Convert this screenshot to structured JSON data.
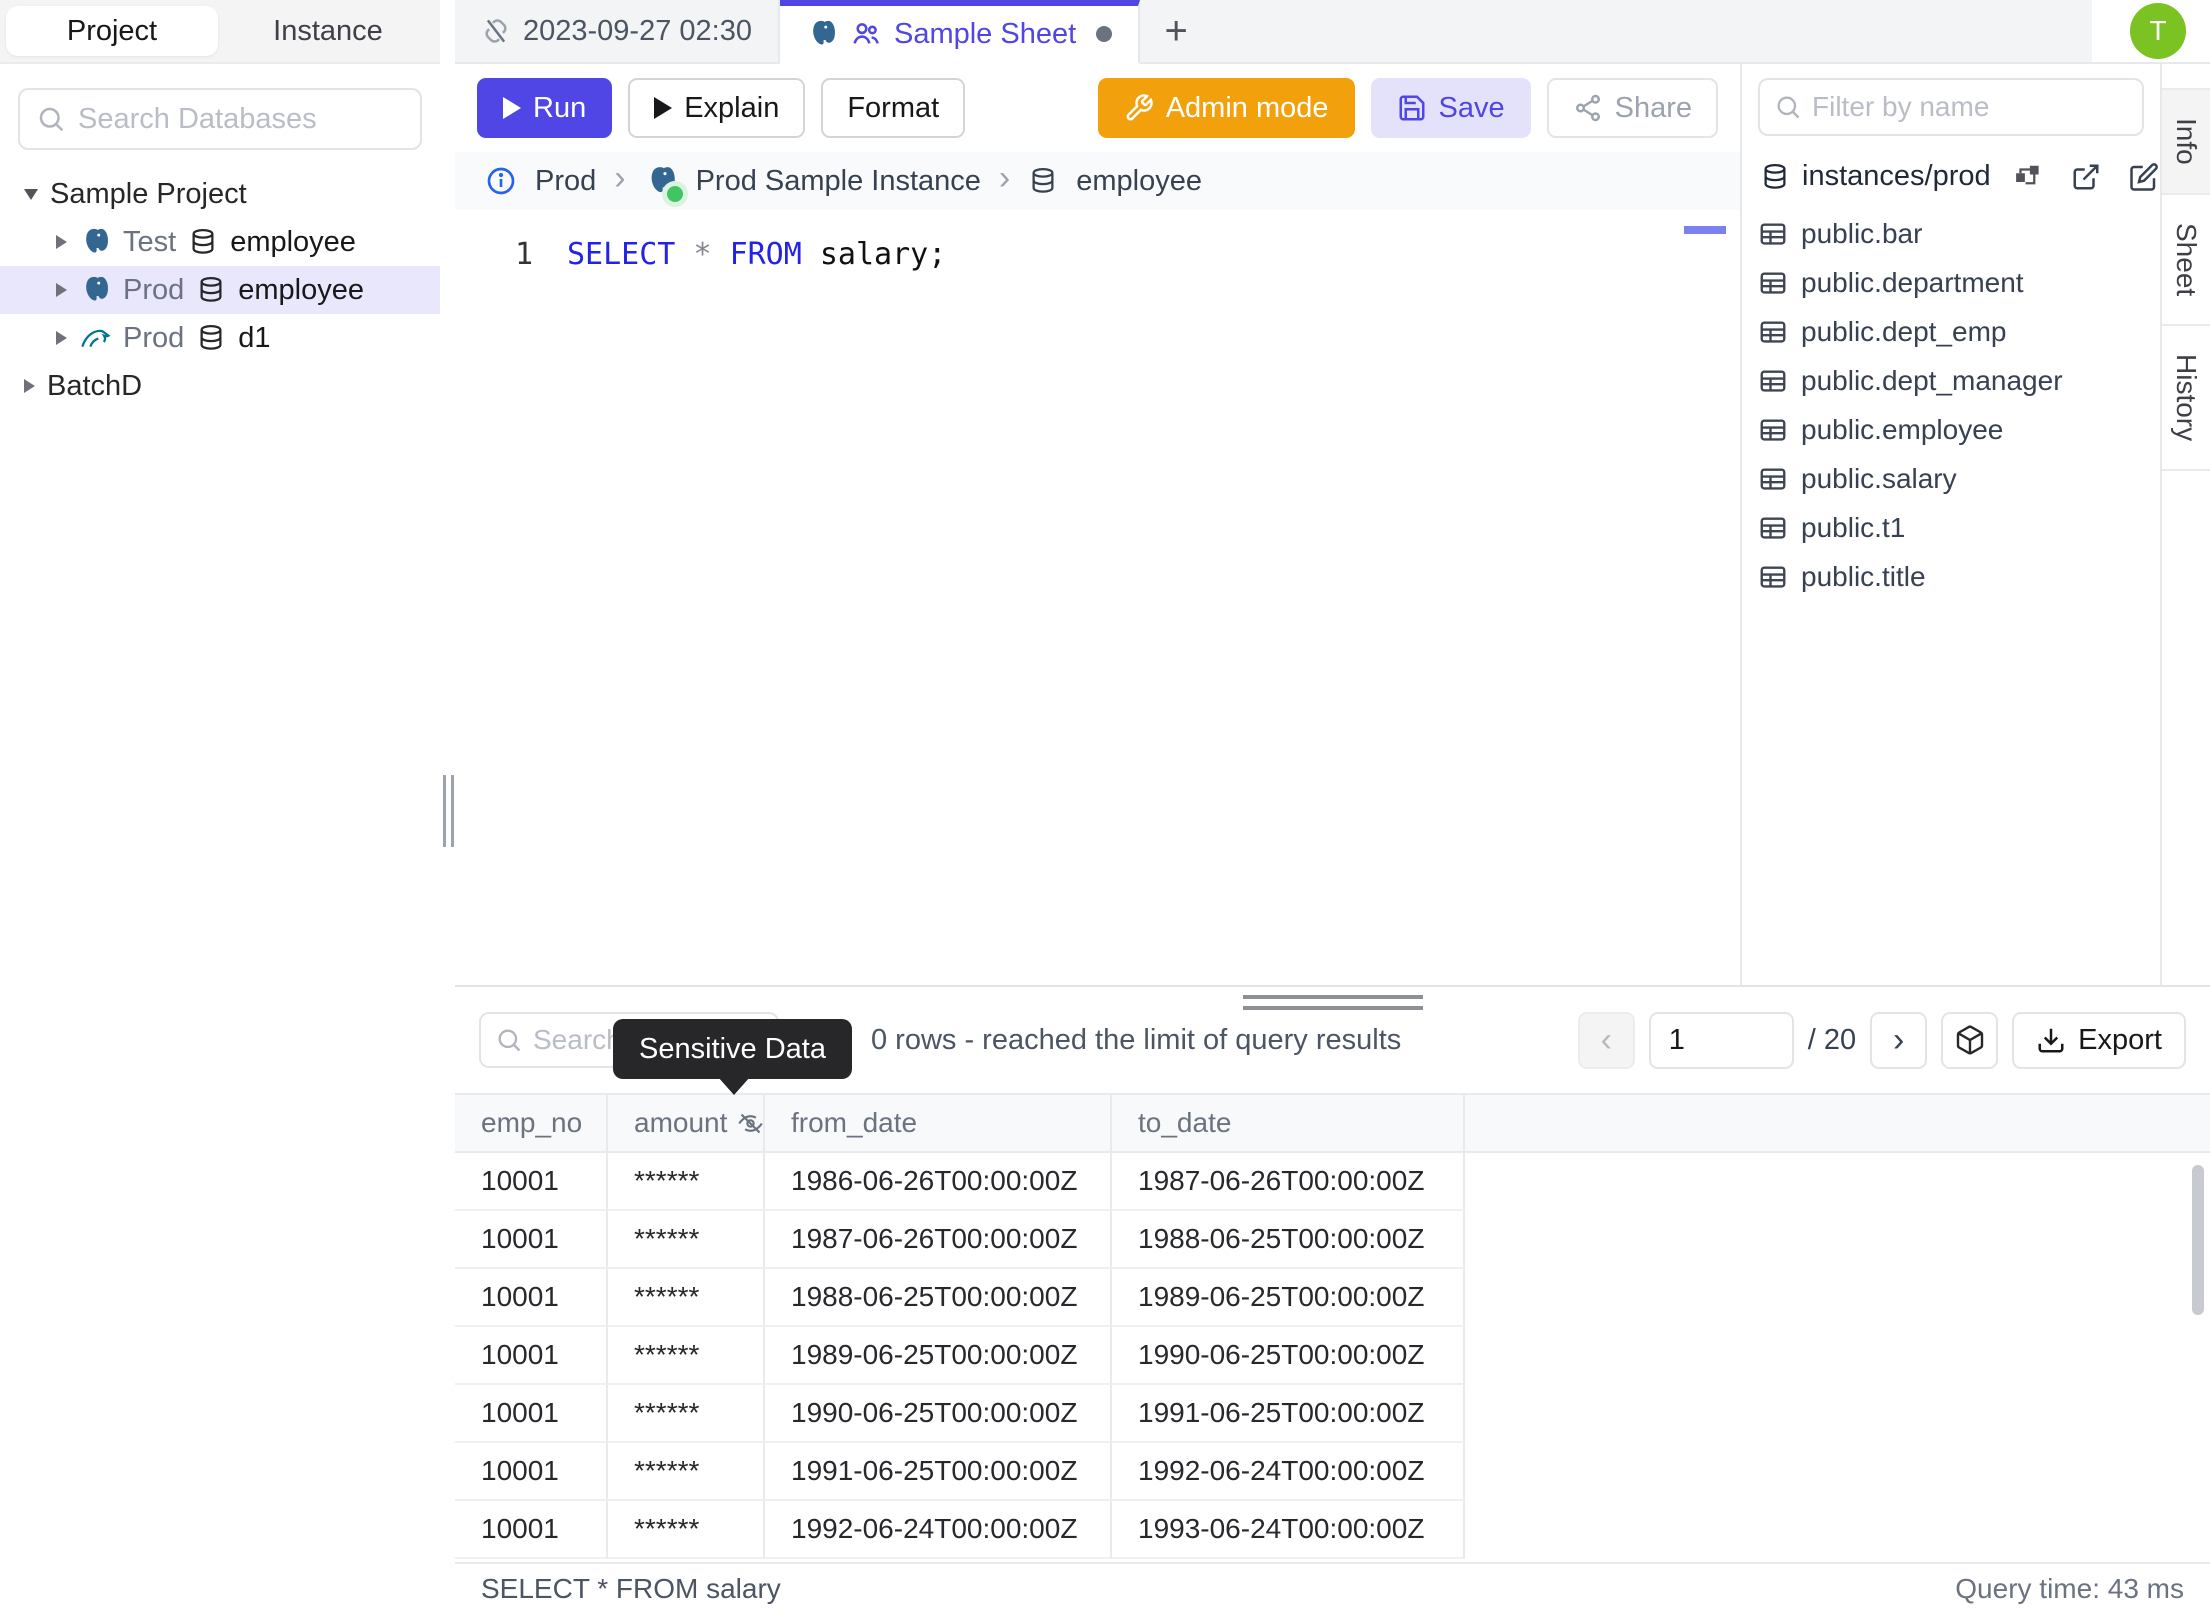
{
  "sidebar": {
    "tabs": [
      {
        "label": "Project",
        "active": true
      },
      {
        "label": "Instance",
        "active": false
      }
    ],
    "search_placeholder": "Search Databases",
    "tree": {
      "project1": {
        "label": "Sample Project"
      },
      "item1": {
        "env": "Test",
        "db": "employee",
        "engine": "postgres"
      },
      "item2": {
        "env": "Prod",
        "db": "employee",
        "engine": "postgres"
      },
      "item3": {
        "env": "Prod",
        "db": "d1",
        "engine": "mysql"
      },
      "project2": {
        "label": "BatchD"
      }
    }
  },
  "tabbar": {
    "tab1": {
      "label": "2023-09-27 02:30"
    },
    "tab2": {
      "label": "Sample Sheet"
    },
    "new_tab_label": "+"
  },
  "header": {
    "avatar_initial": "T"
  },
  "toolbar": {
    "run_label": "Run",
    "explain_label": "Explain",
    "format_label": "Format",
    "admin_mode_label": "Admin mode",
    "save_label": "Save",
    "share_label": "Share"
  },
  "breadcrumb": {
    "environment": "Prod",
    "instance": "Prod Sample Instance",
    "database": "employee",
    "separator": "›"
  },
  "editor": {
    "line_number": "1",
    "keyword_select": "SELECT",
    "star": "*",
    "keyword_from": "FROM",
    "rest": "salary;"
  },
  "right_panel": {
    "filter_placeholder": "Filter by name",
    "schema_title": "instances/prod",
    "tables": [
      "public.bar",
      "public.department",
      "public.dept_emp",
      "public.dept_manager",
      "public.employee",
      "public.salary",
      "public.t1",
      "public.title"
    ]
  },
  "side_tabs": {
    "info": "Info",
    "sheet": "Sheet",
    "history": "History"
  },
  "results": {
    "search_placeholder": "Search",
    "tooltip": "Sensitive Data",
    "rows_info": "0 rows  -  reached the limit of query results",
    "pagination": {
      "prev": "‹",
      "page": "1",
      "total": "/ 20",
      "next": "›"
    },
    "export_label": "Export",
    "table": {
      "columns": [
        "emp_no",
        "amount",
        "from_date",
        "to_date"
      ],
      "masked_column": "amount",
      "rows": [
        [
          "10001",
          "******",
          "1986-06-26T00:00:00Z",
          "1987-06-26T00:00:00Z"
        ],
        [
          "10001",
          "******",
          "1987-06-26T00:00:00Z",
          "1988-06-25T00:00:00Z"
        ],
        [
          "10001",
          "******",
          "1988-06-25T00:00:00Z",
          "1989-06-25T00:00:00Z"
        ],
        [
          "10001",
          "******",
          "1989-06-25T00:00:00Z",
          "1990-06-25T00:00:00Z"
        ],
        [
          "10001",
          "******",
          "1990-06-25T00:00:00Z",
          "1991-06-25T00:00:00Z"
        ],
        [
          "10001",
          "******",
          "1991-06-25T00:00:00Z",
          "1992-06-24T00:00:00Z"
        ],
        [
          "10001",
          "******",
          "1992-06-24T00:00:00Z",
          "1993-06-24T00:00:00Z"
        ]
      ]
    },
    "status_query": "SELECT * FROM salary",
    "status_time": "Query time: 43 ms"
  },
  "colors": {
    "accent": "#4f46e5",
    "admin_orange": "#f2a10c",
    "avatar_green": "#7bc223",
    "selected_row": "#e9e7fc",
    "keyword_blue": "#2323e6",
    "status_green": "#41c463"
  }
}
